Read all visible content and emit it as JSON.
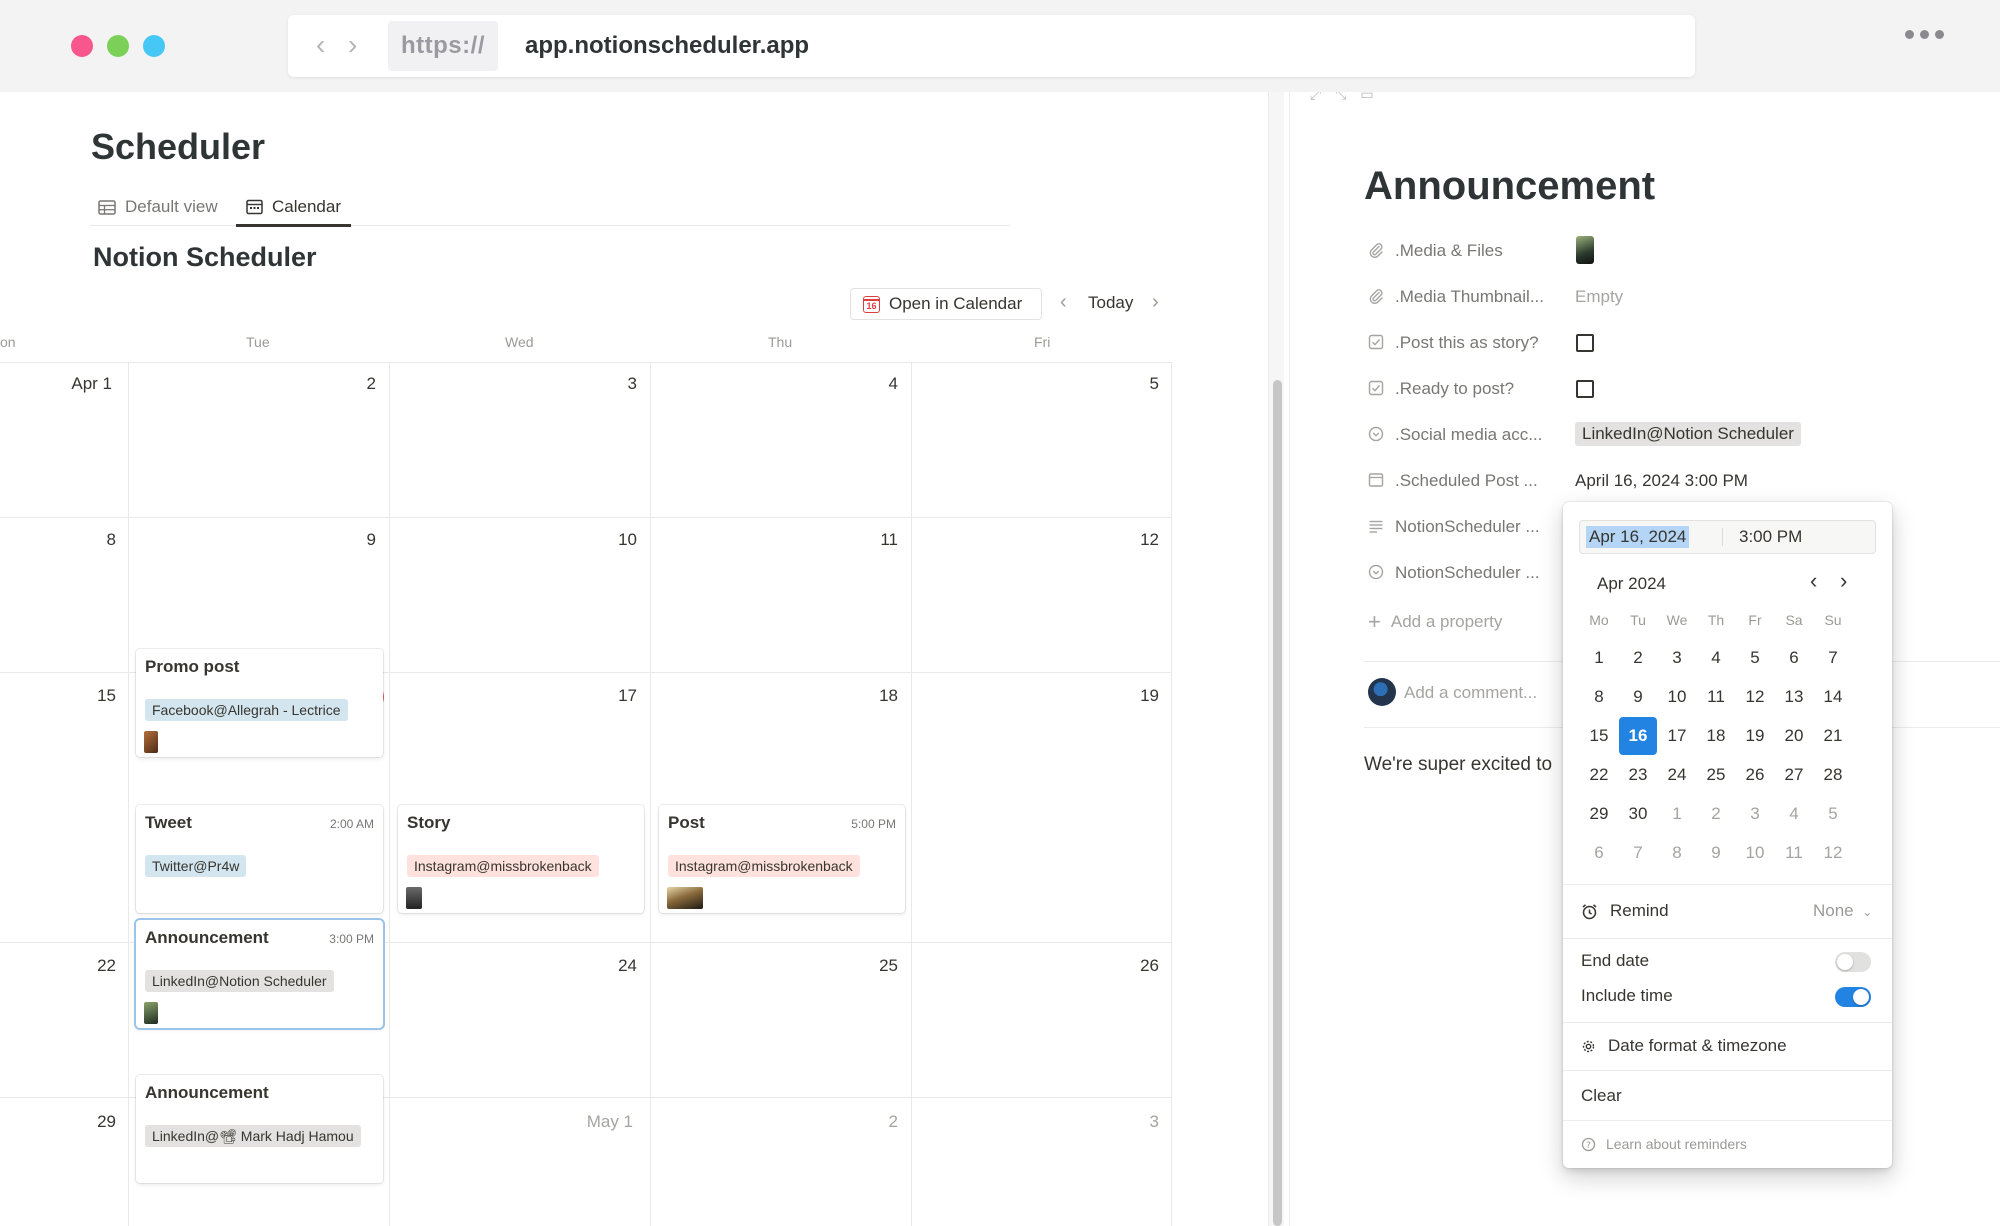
{
  "browser": {
    "scheme": "https://",
    "host": "app.notionscheduler.app"
  },
  "page": {
    "title": "Scheduler",
    "views": [
      {
        "label": "Default view"
      },
      {
        "label": "Calendar"
      }
    ],
    "database_title": "Notion Scheduler"
  },
  "calendar": {
    "toolbar": {
      "open_in_calendar": "Open in Calendar",
      "badge": "16",
      "today": "Today"
    },
    "weekdays": [
      "on",
      "Tue",
      "Wed",
      "Thu",
      "Fri"
    ],
    "weeks": [
      [
        "Apr 1",
        "2",
        "3",
        "4",
        "5"
      ],
      [
        "8",
        "9",
        "10",
        "11",
        "12"
      ],
      [
        "15",
        "16",
        "17",
        "18",
        "19"
      ],
      [
        "22",
        "23",
        "24",
        "25",
        "26"
      ],
      [
        "29",
        "30",
        "May 1",
        "2",
        "3"
      ]
    ],
    "events": [
      {
        "title": "Promo post",
        "time": "",
        "tag": "Facebook@Allegrah - Lectrice",
        "color": "blue"
      },
      {
        "title": "Tweet",
        "time": "2:00 AM",
        "tag": "Twitter@Pr4w",
        "color": "blue"
      },
      {
        "title": "Announcement",
        "time": "3:00 PM",
        "tag": "LinkedIn@Notion Scheduler",
        "color": "gray"
      },
      {
        "title": "Story",
        "time": "",
        "tag": "Instagram@missbrokenback",
        "color": "pink"
      },
      {
        "title": "Post",
        "time": "5:00 PM",
        "tag": "Instagram@missbrokenback",
        "color": "pink"
      },
      {
        "title": "Announcement",
        "time": "",
        "tag": "LinkedIn@📽 Mark Hadj Hamou",
        "color": "gray"
      }
    ]
  },
  "peek": {
    "title": "Announcement",
    "properties": [
      {
        "name": ".Media & Files",
        "icon": "paperclip-icon",
        "value": ""
      },
      {
        "name": ".Media Thumbnail...",
        "icon": "paperclip-icon",
        "value": "Empty"
      },
      {
        "name": ".Post this as story?",
        "icon": "checkbox-icon",
        "value": ""
      },
      {
        "name": ".Ready to post?",
        "icon": "checkbox-icon",
        "value": ""
      },
      {
        "name": ".Social media acc...",
        "icon": "select-icon",
        "value": "LinkedIn@Notion Scheduler"
      },
      {
        "name": ".Scheduled Post ...",
        "icon": "calendar-icon",
        "value": "April 16, 2024 3:00 PM"
      },
      {
        "name": "NotionScheduler ...",
        "icon": "text-lines-icon",
        "value": ""
      },
      {
        "name": "NotionScheduler ...",
        "icon": "select-icon",
        "value": ""
      }
    ],
    "add_property": "Add a property",
    "comment_placeholder": "Add a comment...",
    "body": "We're super excited to"
  },
  "date_picker": {
    "date_value": "Apr 16, 2024",
    "time_value": "3:00 PM",
    "month_label": "Apr 2024",
    "weekdays": [
      "Mo",
      "Tu",
      "We",
      "Th",
      "Fr",
      "Sa",
      "Su"
    ],
    "weeks": [
      [
        "1",
        "2",
        "3",
        "4",
        "5",
        "6",
        "7"
      ],
      [
        "8",
        "9",
        "10",
        "11",
        "12",
        "13",
        "14"
      ],
      [
        "15",
        "16",
        "17",
        "18",
        "19",
        "20",
        "21"
      ],
      [
        "22",
        "23",
        "24",
        "25",
        "26",
        "27",
        "28"
      ],
      [
        "29",
        "30",
        "1",
        "2",
        "3",
        "4",
        "5"
      ],
      [
        "6",
        "7",
        "8",
        "9",
        "10",
        "11",
        "12"
      ]
    ],
    "selected_day": "16",
    "remind_label": "Remind",
    "remind_value": "None",
    "end_date_label": "End date",
    "end_date_on": false,
    "include_time_label": "Include time",
    "include_time_on": true,
    "format_label": "Date format & timezone",
    "clear_label": "Clear",
    "learn_label": "Learn about reminders"
  },
  "colors": {
    "accent": "#2383e2",
    "today_badge": "#eb5757",
    "tag_blue": "#d3e5ef",
    "tag_pink": "#ffe2dd",
    "tag_gray": "#e3e2e0"
  }
}
